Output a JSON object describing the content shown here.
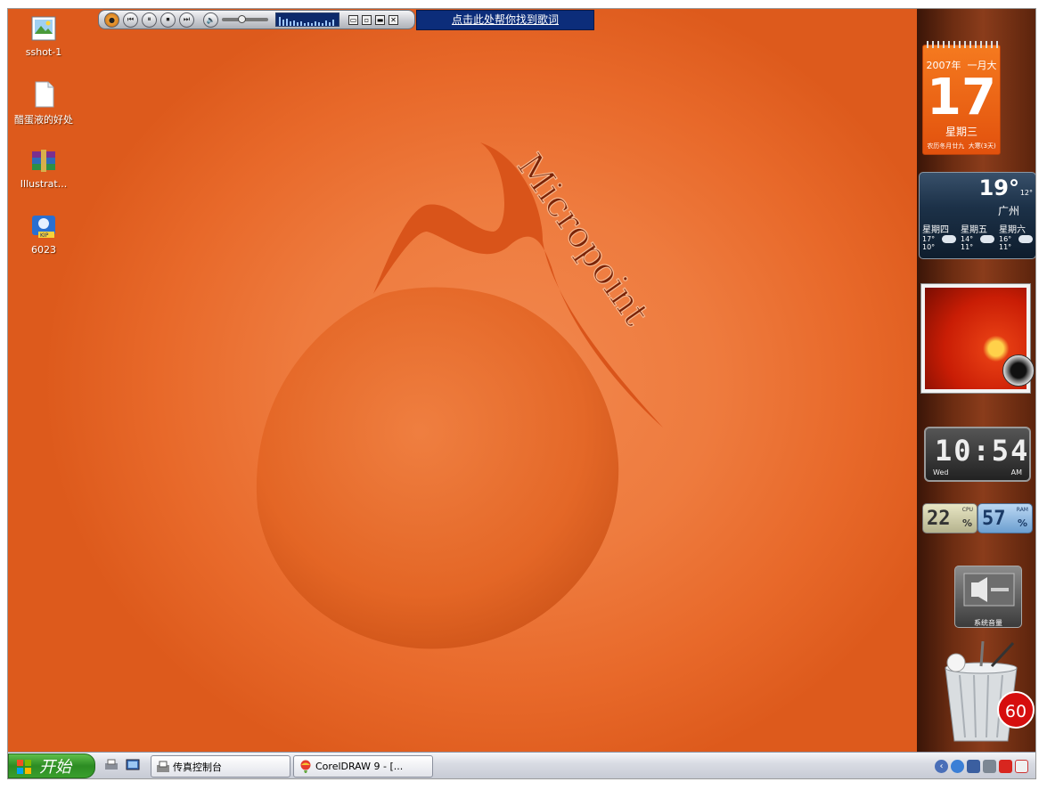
{
  "desktop": {
    "wallpaper_text": "Micropoint",
    "icons": [
      {
        "label": "sshot-1",
        "icon": "image-file-icon"
      },
      {
        "label": "醋蛋液的好处",
        "icon": "blank-document-icon"
      },
      {
        "label": "Illustrat...",
        "icon": "winrar-archive-icon"
      },
      {
        "label": "6023",
        "icon": "kip-app-icon"
      }
    ]
  },
  "player": {
    "lyric_link": "点击此处帮你找到歌词",
    "window_buttons": [
      "▭",
      "▫",
      "▬",
      "✕"
    ]
  },
  "sidebar": {
    "calendar": {
      "year_month": "2007年  一月大",
      "day": "17",
      "weekday": "星期三",
      "lunar": "农历冬月廿九  大寒(3天)"
    },
    "weather": {
      "temp": "19°",
      "low": "12°",
      "city": "广州",
      "forecast": [
        {
          "day": "星期四",
          "high": "17°",
          "low": "10°"
        },
        {
          "day": "星期五",
          "high": "14°",
          "low": "11°"
        },
        {
          "day": "星期六",
          "high": "16°",
          "low": "11°"
        }
      ]
    },
    "clock": {
      "time": "10:54",
      "day": "Wed",
      "ampm": "AM"
    },
    "cpu": {
      "value": "22",
      "label": "CPU",
      "unit": "%"
    },
    "memory": {
      "value": "57",
      "label": "RAM",
      "unit": "%"
    },
    "volume": {
      "label": "系统音量"
    },
    "recycle_bin": {
      "count": "60"
    }
  },
  "taskbar": {
    "start_label": "开始",
    "tasks": [
      {
        "label": "传真控制台"
      },
      {
        "label": "CorelDRAW 9 - [..."
      }
    ]
  },
  "colors": {
    "wallpaper": "#e76a2b",
    "taskbar": "#d8dbe3",
    "start_green": "#2c8c23",
    "lyric_bg": "#0c2d7a",
    "badge_red": "#d60e0e"
  }
}
